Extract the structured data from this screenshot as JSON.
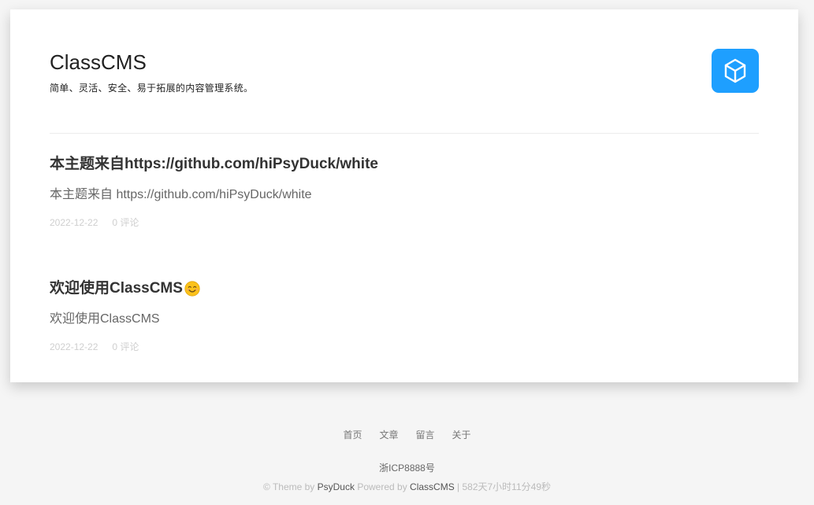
{
  "site": {
    "title": "ClassCMS",
    "description": "简单、灵活、安全、易于拓展的内容管理系统。",
    "accent_color": "#1e9fff",
    "logo_icon": "cube-icon"
  },
  "posts": [
    {
      "title": "本主题来自https://github.com/hiPsyDuck/white",
      "excerpt": "本主题来自 https://github.com/hiPsyDuck/white",
      "date": "2022-12-22",
      "comments": "0 评论"
    },
    {
      "title": "欢迎使用ClassCMS",
      "title_emoji": "smiling-face-emoji",
      "excerpt": "欢迎使用ClassCMS",
      "date": "2022-12-22",
      "comments": "0 评论"
    }
  ],
  "footer": {
    "nav": [
      "首页",
      "文章",
      "留言",
      "关于"
    ],
    "icp": "浙ICP8888号",
    "credit": {
      "theme_prefix": "© Theme by ",
      "theme_name": "PsyDuck",
      "powered_prefix": " Powered by ",
      "powered_name": "ClassCMS",
      "uptime": " | 582天7小时11分49秒"
    }
  }
}
